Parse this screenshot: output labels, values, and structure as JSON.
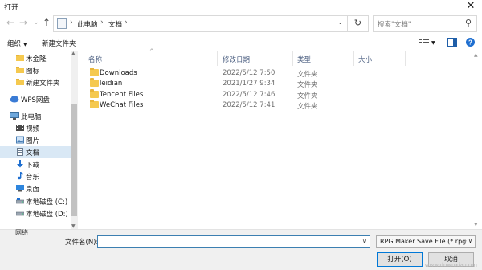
{
  "window": {
    "title": "打开",
    "close_glyph": "✕"
  },
  "nav": {
    "back": "←",
    "forward": "→",
    "recent": "⌄",
    "up": "↑"
  },
  "address": {
    "crumbs": [
      "此电脑",
      "文档"
    ],
    "separator": "›",
    "dropdown": "⌄",
    "refresh": "↻"
  },
  "search": {
    "placeholder": "搜索\"文档\"",
    "icon": "⚲"
  },
  "toolbar": {
    "organize": "组织",
    "organize_arrow": "▼",
    "new_folder": "新建文件夹",
    "view_arrow": "▼",
    "help": "?"
  },
  "columns": {
    "name": "名称",
    "date": "修改日期",
    "type": "类型",
    "size": "大小",
    "sort_glyph": "^"
  },
  "sidebar": {
    "items": [
      {
        "label": "木金隆",
        "icon": "folder-icon"
      },
      {
        "label": "图标",
        "icon": "folder-icon"
      },
      {
        "label": "新建文件夹",
        "icon": "folder-icon"
      },
      {
        "label": "WPS网盘",
        "icon": "cloud-icon"
      },
      {
        "label": "此电脑",
        "icon": "computer-icon"
      },
      {
        "label": "视频",
        "icon": "video-icon"
      },
      {
        "label": "图片",
        "icon": "picture-icon"
      },
      {
        "label": "文档",
        "icon": "document-icon"
      },
      {
        "label": "下载",
        "icon": "download-icon"
      },
      {
        "label": "音乐",
        "icon": "music-icon"
      },
      {
        "label": "桌面",
        "icon": "desktop-icon"
      },
      {
        "label": "本地磁盘 (C:)",
        "icon": "drive-icon"
      },
      {
        "label": "本地磁盘 (D:)",
        "icon": "drive-icon"
      }
    ],
    "selected": "文档"
  },
  "files": [
    {
      "name": "Downloads",
      "date": "2022/5/12 7:50",
      "type": "文件夹"
    },
    {
      "name": "leidian",
      "date": "2021/1/27 9:34",
      "type": "文件夹"
    },
    {
      "name": "Tencent Files",
      "date": "2022/5/12 7:46",
      "type": "文件夹"
    },
    {
      "name": "WeChat Files",
      "date": "2022/5/12 7:41",
      "type": "文件夹"
    }
  ],
  "bottom": {
    "partial_item": "网络",
    "filename_label": "文件名(N):",
    "filename_value": "",
    "filter_text": "RPG Maker Save File (*.rpgs",
    "dropdown": "∨",
    "open_label": "打开(O)",
    "cancel_label": "取消"
  },
  "watermark": "www.downxia.com",
  "colors": {
    "accent": "#0078d7",
    "selected": "#d9e8f5",
    "folder": "#f5c94f"
  }
}
